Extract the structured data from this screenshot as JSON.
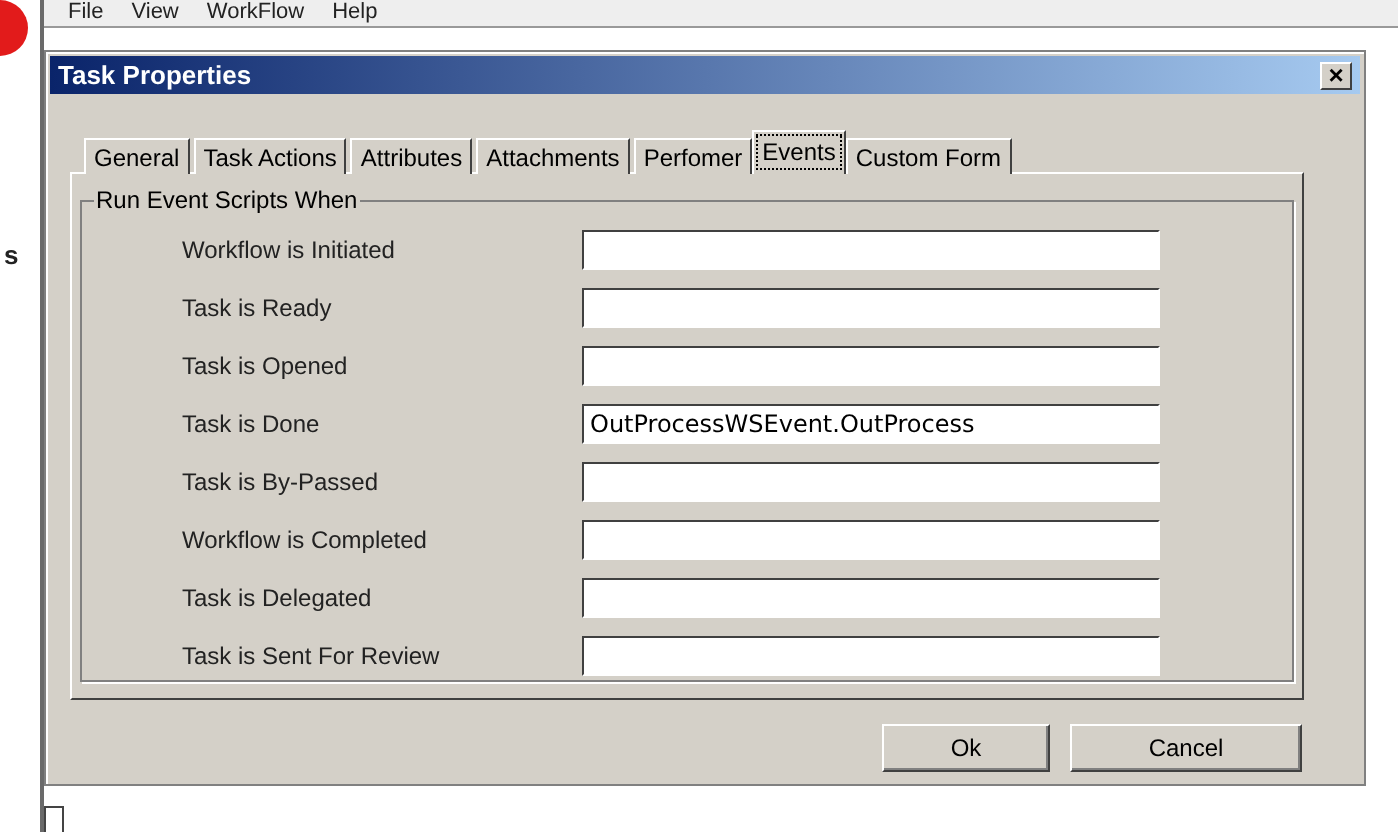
{
  "app": {
    "menu": [
      "File",
      "View",
      "WorkFlow",
      "Help"
    ],
    "side_fragment": "s"
  },
  "dialog": {
    "title": "Task Properties",
    "close": "×",
    "tabs": [
      {
        "label": "General",
        "selected": false
      },
      {
        "label": "Task Actions",
        "selected": false
      },
      {
        "label": "Attributes",
        "selected": false
      },
      {
        "label": "Attachments",
        "selected": false
      },
      {
        "label": "Perfomer",
        "selected": false
      },
      {
        "label": "Events",
        "selected": true
      },
      {
        "label": "Custom Form",
        "selected": false
      }
    ],
    "group": {
      "title": "Run Event Scripts When",
      "rows": [
        {
          "label": "Workflow is Initiated"
        },
        {
          "label": "Task is Ready"
        },
        {
          "label": "Task is Opened"
        },
        {
          "label": "Task is Done",
          "value": "OutProcessWSEvent.OutProcess"
        },
        {
          "label": "Task is By-Passed"
        },
        {
          "label": "Workflow is Completed"
        },
        {
          "label": "Task is Delegated"
        },
        {
          "label": "Task is Sent For Review"
        }
      ]
    },
    "buttons": [
      "Ok",
      "Cancel"
    ]
  }
}
